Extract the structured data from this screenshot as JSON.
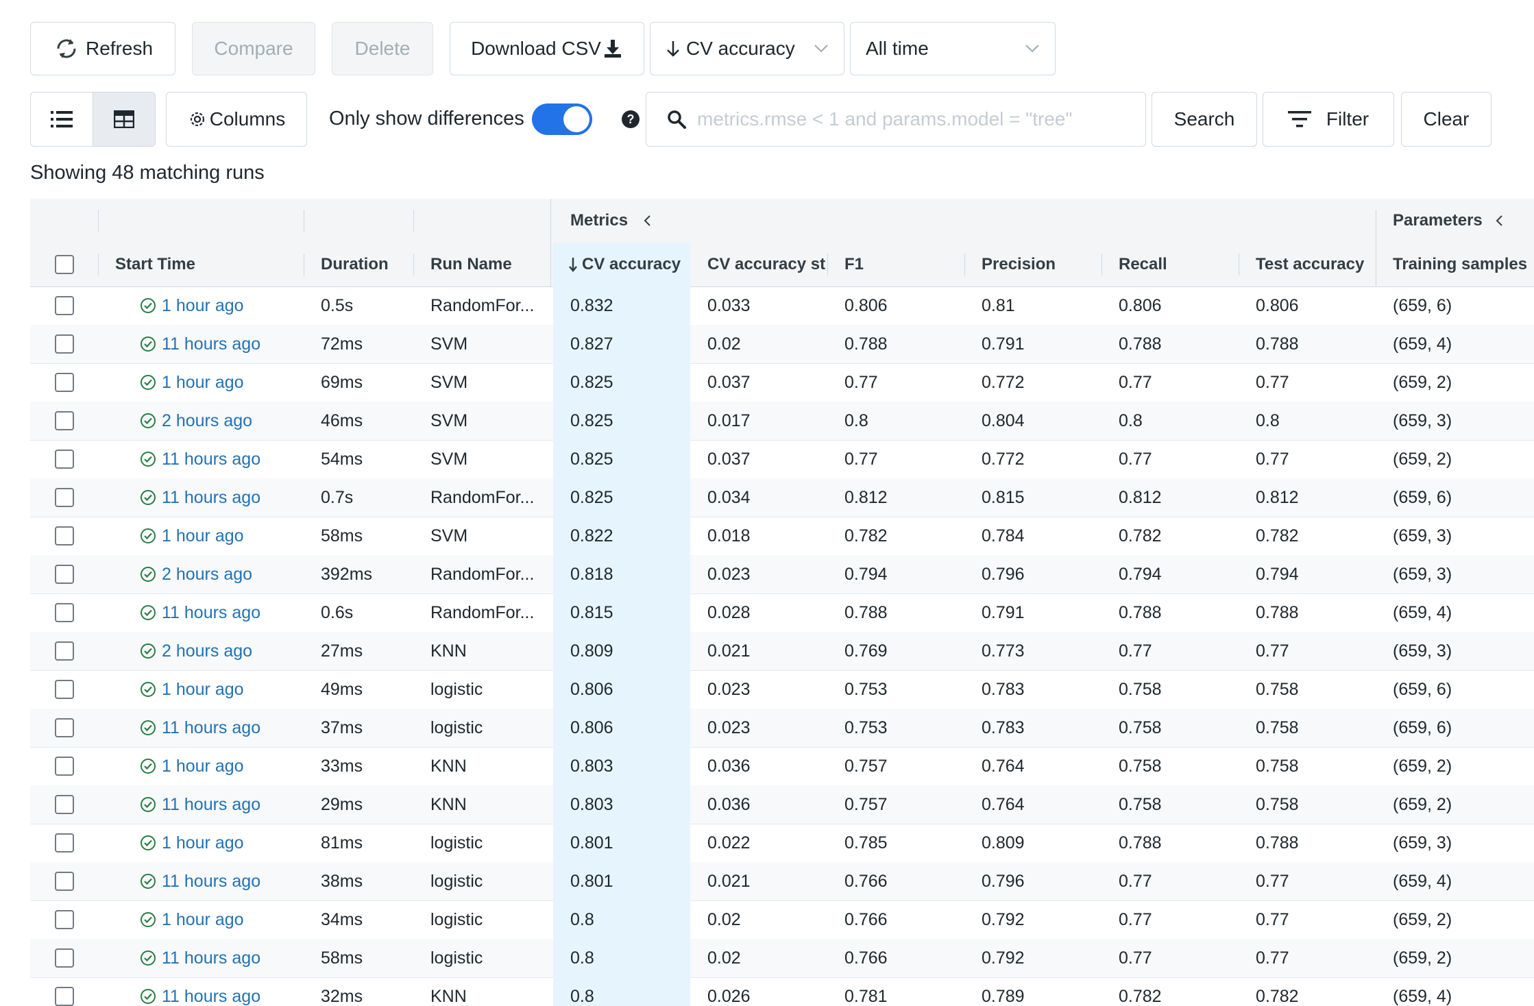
{
  "toolbar": {
    "refresh_label": "Refresh",
    "compare_label": "Compare",
    "delete_label": "Delete",
    "download_label": "Download CSV",
    "sort_label": "CV accuracy",
    "time_range_label": "All time",
    "columns_label": "Columns",
    "only_diff_label": "Only show differences",
    "only_diff_on": true,
    "search_placeholder": "metrics.rmse < 1 and params.model = \"tree\"",
    "search_value": "",
    "search_button": "Search",
    "filter_label": "Filter",
    "clear_label": "Clear"
  },
  "summary": "Showing 48 matching runs",
  "table": {
    "groups": {
      "metrics": "Metrics",
      "parameters": "Parameters"
    },
    "columns": {
      "start_time": "Start Time",
      "duration": "Duration",
      "run_name": "Run Name",
      "cv_accuracy": "CV accuracy",
      "cv_accuracy_std": "CV accuracy st",
      "f1": "F1",
      "precision": "Precision",
      "recall": "Recall",
      "test_accuracy": "Test accuracy",
      "training_samples": "Training samples"
    },
    "rows": [
      {
        "start": "1 hour ago",
        "duration": "0.5s",
        "name": "RandomFor...",
        "cv": "0.832",
        "cvstd": "0.033",
        "f1": "0.806",
        "precision": "0.81",
        "recall": "0.806",
        "test": "0.806",
        "samples": "(659, 6)"
      },
      {
        "start": "11 hours ago",
        "duration": "72ms",
        "name": "SVM",
        "cv": "0.827",
        "cvstd": "0.02",
        "f1": "0.788",
        "precision": "0.791",
        "recall": "0.788",
        "test": "0.788",
        "samples": "(659, 4)"
      },
      {
        "start": "1 hour ago",
        "duration": "69ms",
        "name": "SVM",
        "cv": "0.825",
        "cvstd": "0.037",
        "f1": "0.77",
        "precision": "0.772",
        "recall": "0.77",
        "test": "0.77",
        "samples": "(659, 2)"
      },
      {
        "start": "2 hours ago",
        "duration": "46ms",
        "name": "SVM",
        "cv": "0.825",
        "cvstd": "0.017",
        "f1": "0.8",
        "precision": "0.804",
        "recall": "0.8",
        "test": "0.8",
        "samples": "(659, 3)"
      },
      {
        "start": "11 hours ago",
        "duration": "54ms",
        "name": "SVM",
        "cv": "0.825",
        "cvstd": "0.037",
        "f1": "0.77",
        "precision": "0.772",
        "recall": "0.77",
        "test": "0.77",
        "samples": "(659, 2)"
      },
      {
        "start": "11 hours ago",
        "duration": "0.7s",
        "name": "RandomFor...",
        "cv": "0.825",
        "cvstd": "0.034",
        "f1": "0.812",
        "precision": "0.815",
        "recall": "0.812",
        "test": "0.812",
        "samples": "(659, 6)"
      },
      {
        "start": "1 hour ago",
        "duration": "58ms",
        "name": "SVM",
        "cv": "0.822",
        "cvstd": "0.018",
        "f1": "0.782",
        "precision": "0.784",
        "recall": "0.782",
        "test": "0.782",
        "samples": "(659, 3)"
      },
      {
        "start": "2 hours ago",
        "duration": "392ms",
        "name": "RandomFor...",
        "cv": "0.818",
        "cvstd": "0.023",
        "f1": "0.794",
        "precision": "0.796",
        "recall": "0.794",
        "test": "0.794",
        "samples": "(659, 3)"
      },
      {
        "start": "11 hours ago",
        "duration": "0.6s",
        "name": "RandomFor...",
        "cv": "0.815",
        "cvstd": "0.028",
        "f1": "0.788",
        "precision": "0.791",
        "recall": "0.788",
        "test": "0.788",
        "samples": "(659, 4)"
      },
      {
        "start": "2 hours ago",
        "duration": "27ms",
        "name": "KNN",
        "cv": "0.809",
        "cvstd": "0.021",
        "f1": "0.769",
        "precision": "0.773",
        "recall": "0.77",
        "test": "0.77",
        "samples": "(659, 3)"
      },
      {
        "start": "1 hour ago",
        "duration": "49ms",
        "name": "logistic",
        "cv": "0.806",
        "cvstd": "0.023",
        "f1": "0.753",
        "precision": "0.783",
        "recall": "0.758",
        "test": "0.758",
        "samples": "(659, 6)"
      },
      {
        "start": "11 hours ago",
        "duration": "37ms",
        "name": "logistic",
        "cv": "0.806",
        "cvstd": "0.023",
        "f1": "0.753",
        "precision": "0.783",
        "recall": "0.758",
        "test": "0.758",
        "samples": "(659, 6)"
      },
      {
        "start": "1 hour ago",
        "duration": "33ms",
        "name": "KNN",
        "cv": "0.803",
        "cvstd": "0.036",
        "f1": "0.757",
        "precision": "0.764",
        "recall": "0.758",
        "test": "0.758",
        "samples": "(659, 2)"
      },
      {
        "start": "11 hours ago",
        "duration": "29ms",
        "name": "KNN",
        "cv": "0.803",
        "cvstd": "0.036",
        "f1": "0.757",
        "precision": "0.764",
        "recall": "0.758",
        "test": "0.758",
        "samples": "(659, 2)"
      },
      {
        "start": "1 hour ago",
        "duration": "81ms",
        "name": "logistic",
        "cv": "0.801",
        "cvstd": "0.022",
        "f1": "0.785",
        "precision": "0.809",
        "recall": "0.788",
        "test": "0.788",
        "samples": "(659, 3)"
      },
      {
        "start": "11 hours ago",
        "duration": "38ms",
        "name": "logistic",
        "cv": "0.801",
        "cvstd": "0.021",
        "f1": "0.766",
        "precision": "0.796",
        "recall": "0.77",
        "test": "0.77",
        "samples": "(659, 4)"
      },
      {
        "start": "1 hour ago",
        "duration": "34ms",
        "name": "logistic",
        "cv": "0.8",
        "cvstd": "0.02",
        "f1": "0.766",
        "precision": "0.792",
        "recall": "0.77",
        "test": "0.77",
        "samples": "(659, 2)"
      },
      {
        "start": "11 hours ago",
        "duration": "58ms",
        "name": "logistic",
        "cv": "0.8",
        "cvstd": "0.02",
        "f1": "0.766",
        "precision": "0.792",
        "recall": "0.77",
        "test": "0.77",
        "samples": "(659, 2)"
      },
      {
        "start": "11 hours ago",
        "duration": "32ms",
        "name": "KNN",
        "cv": "0.8",
        "cvstd": "0.026",
        "f1": "0.781",
        "precision": "0.789",
        "recall": "0.782",
        "test": "0.782",
        "samples": "(659, 4)"
      }
    ]
  },
  "colors": {
    "accent": "#2272e8",
    "link": "#2272b4",
    "success": "#277c43",
    "sorted_column_bg": "#e6f4fd"
  }
}
